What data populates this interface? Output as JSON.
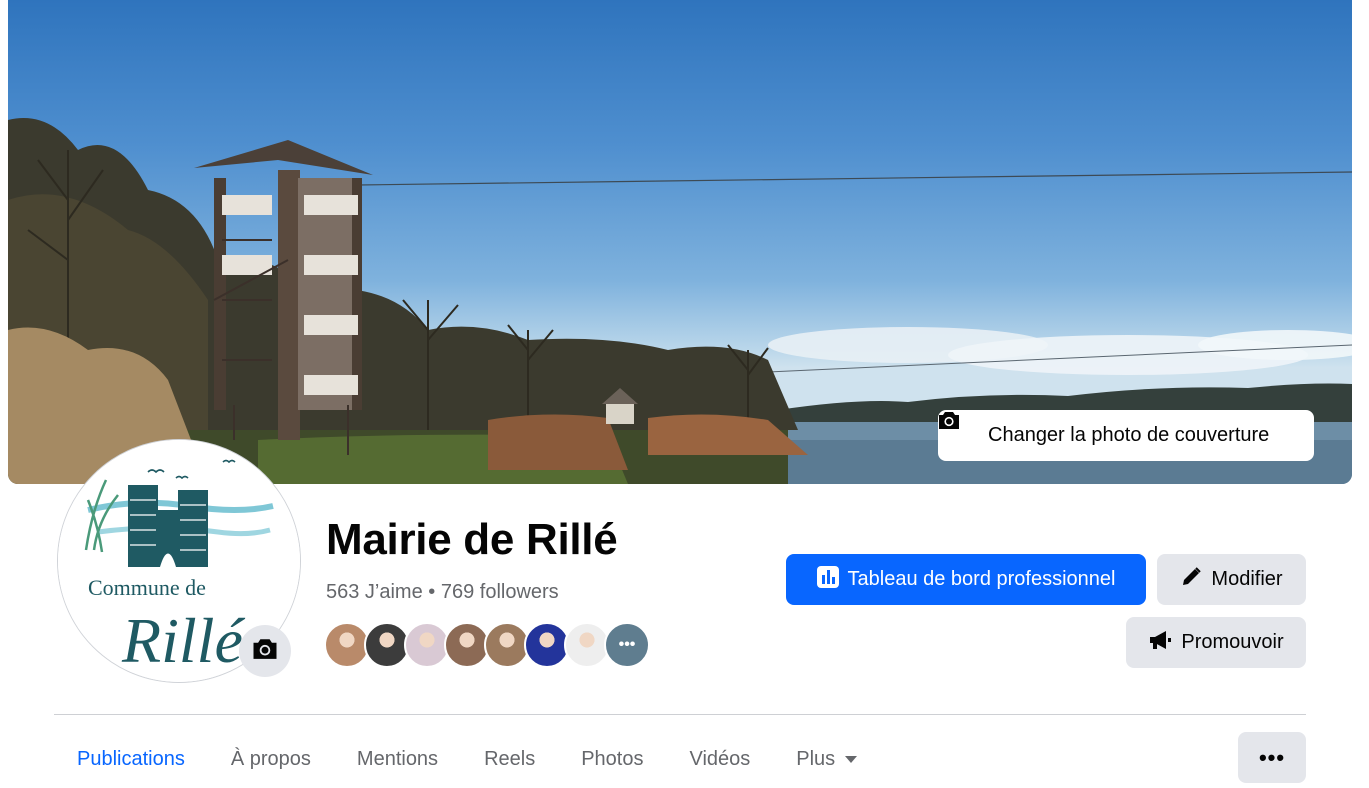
{
  "cover": {
    "change_button_label": "Changer la photo de couverture",
    "icon": "camera-icon"
  },
  "profile": {
    "avatar_text_line1": "Commune de",
    "avatar_text_line2": "Rillé",
    "avatar_camera_icon": "camera-icon",
    "name": "Mairie de Rillé",
    "likes": "563 J’aime",
    "separator": " • ",
    "followers": "769 followers",
    "friend_avatars_colors": [
      "#b98a6a",
      "#3c3c3c",
      "#d9c9d4",
      "#8c6a55",
      "#9b7a5e",
      "#23349b",
      "#eeeeee",
      "#5f7d8f"
    ],
    "more_friends_label": "•••"
  },
  "actions": {
    "dashboard_label": "Tableau de bord professionnel",
    "dashboard_icon": "chart-icon",
    "edit_label": "Modifier",
    "edit_icon": "pencil-icon",
    "promote_label": "Promouvoir",
    "promote_icon": "megaphone-icon"
  },
  "tabs": [
    {
      "label": "Publications",
      "active": true
    },
    {
      "label": "À propos"
    },
    {
      "label": "Mentions"
    },
    {
      "label": "Reels"
    },
    {
      "label": "Photos"
    },
    {
      "label": "Vidéos"
    },
    {
      "label": "Plus"
    }
  ],
  "more_button_label": "•••",
  "colors": {
    "accent": "#0866ff",
    "secondary_button": "#e4e6eb",
    "muted_text": "#65676b",
    "logo_teal": "#1f5a63"
  }
}
